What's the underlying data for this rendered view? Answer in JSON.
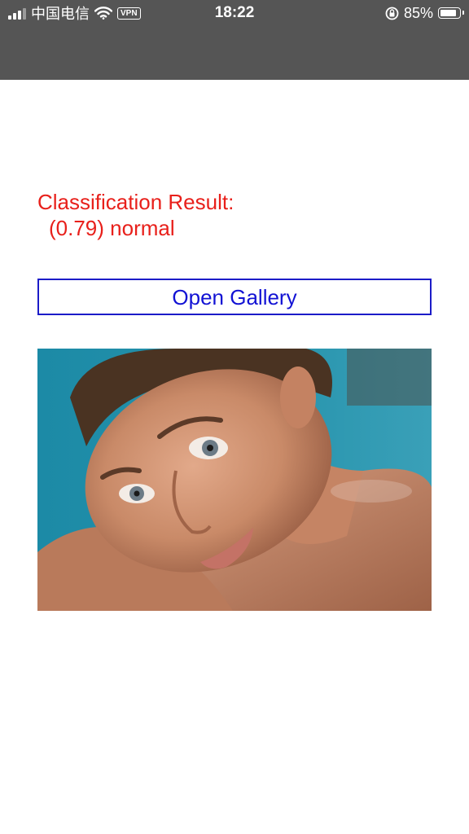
{
  "status_bar": {
    "carrier": "中国电信",
    "vpn": "VPN",
    "time": "18:22",
    "battery_percent": "85%",
    "battery_level": 0.85,
    "background_color": "#555555"
  },
  "result": {
    "label": "Classification Result:",
    "value": "(0.79) normal",
    "color": "#e8201b"
  },
  "gallery_button": {
    "label": "Open Gallery",
    "color": "#1212d4"
  },
  "photo": {
    "icon": "portrait-photo"
  }
}
